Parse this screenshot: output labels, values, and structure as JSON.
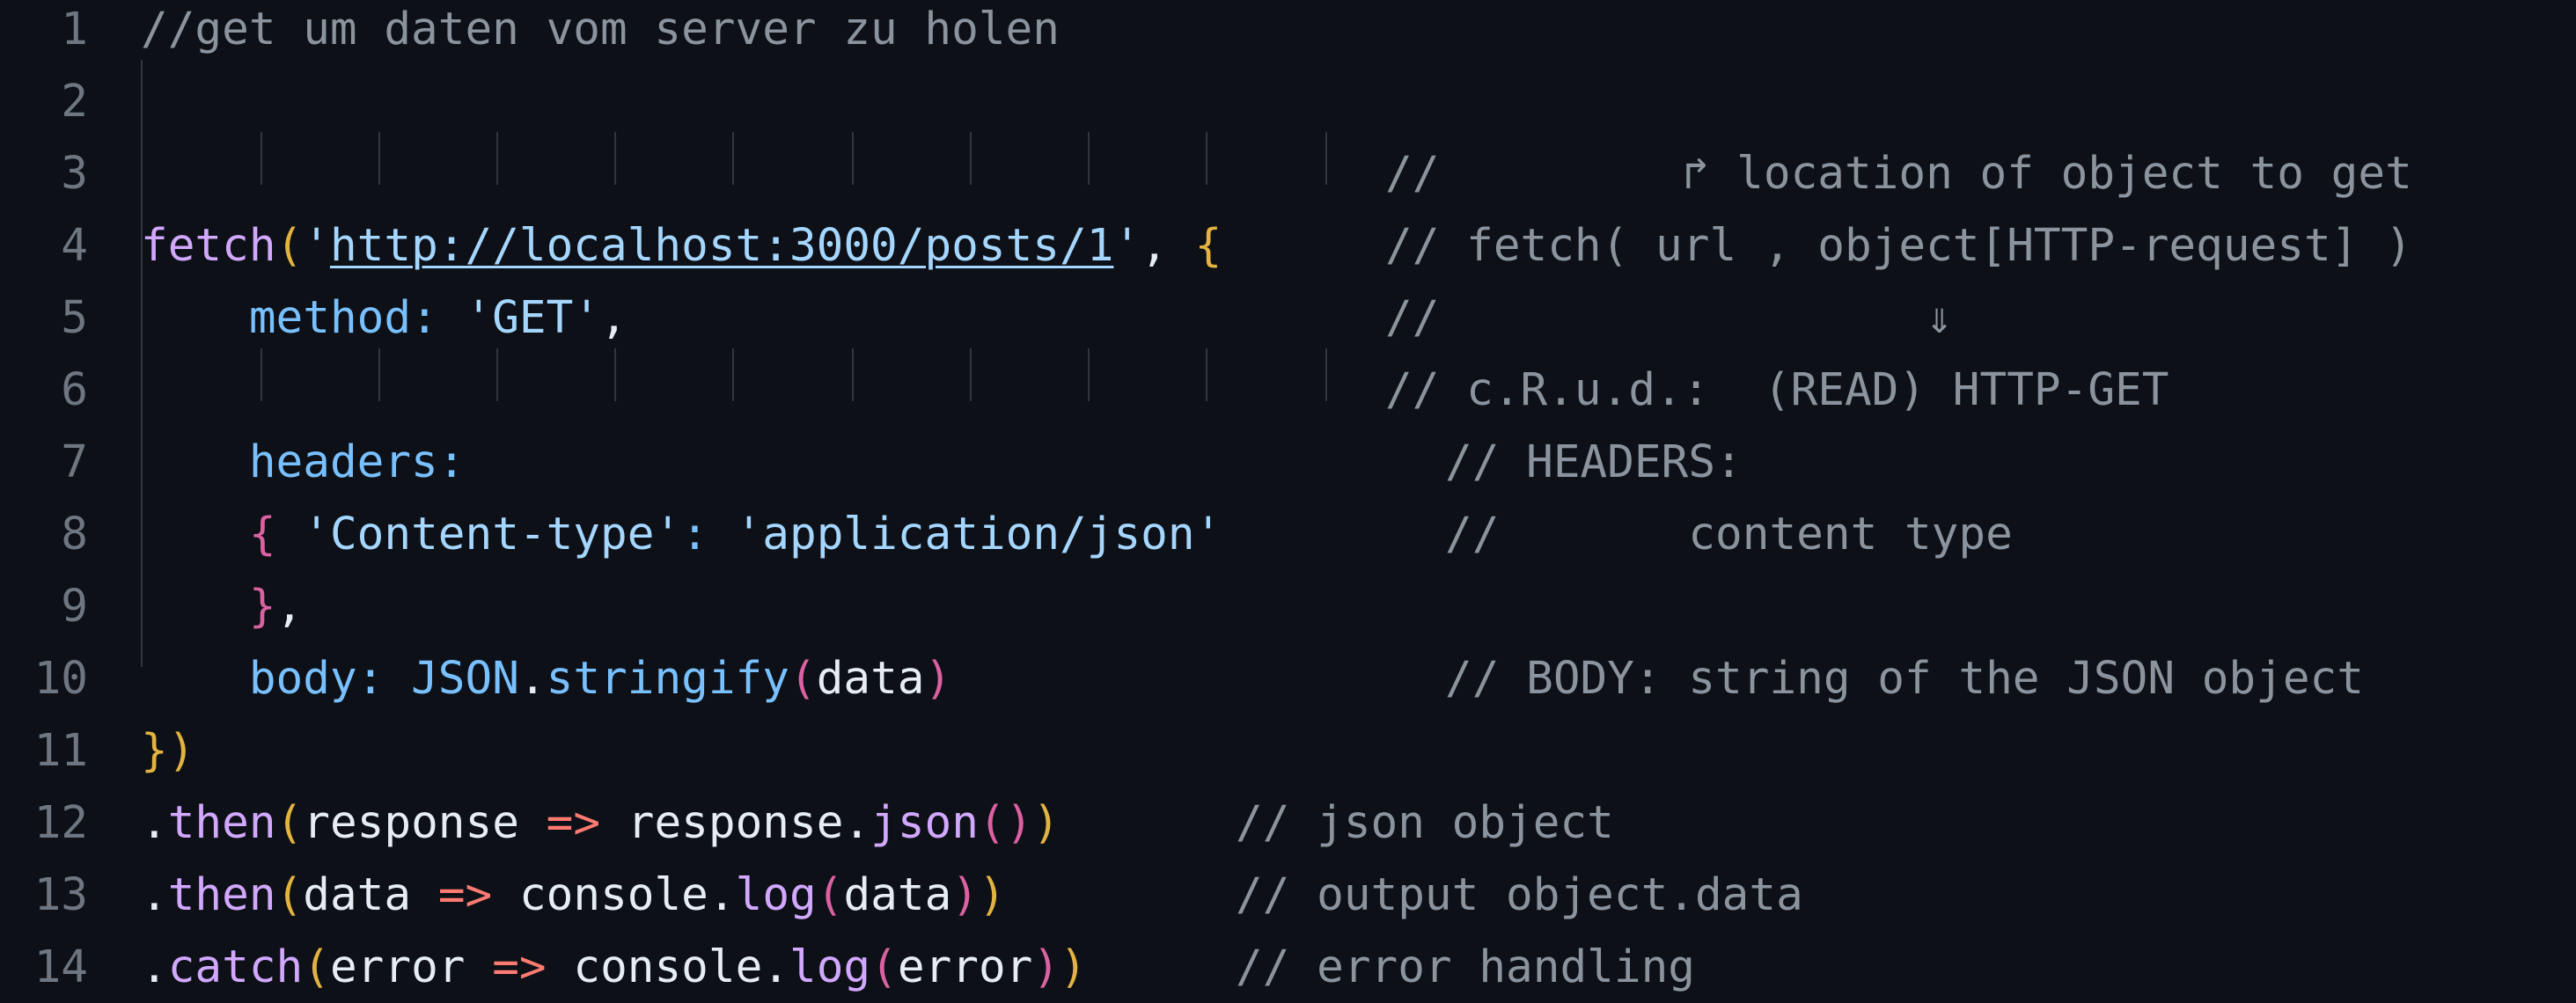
{
  "editor": {
    "line_numbers": [
      "1",
      "2",
      "3",
      "4",
      "5",
      "6",
      "7",
      "8",
      "9",
      "10",
      "11",
      "12",
      "13",
      "14"
    ],
    "colors": {
      "background": "#0d1117",
      "comment": "#8b949e",
      "line_number": "#6e7681",
      "function": "#d2a8ff",
      "property": "#79c0ff",
      "string": "#a5d6ff",
      "bracket_yellow": "#e3b341",
      "bracket_pink": "#db61a2",
      "operator": "#ff7b72"
    },
    "lines": {
      "l1": {
        "comment": "//get um daten vom server zu holen"
      },
      "l3": {
        "comment": "//         ↱ location of object to get"
      },
      "l4": {
        "fetch": "fetch",
        "paren_open": "(",
        "quote_open": "'",
        "url": "http://localhost:3000/posts/1",
        "quote_close": "'",
        "comma": ",",
        "brace_open": "{",
        "comment": "// fetch( url , object[HTTP-request] )"
      },
      "l5": {
        "key": "method:",
        "value": "'GET'",
        "comma": ",",
        "comment": "//                  ⇓"
      },
      "l6": {
        "comment": "// c.R.u.d.:  (READ) HTTP-GET"
      },
      "l7": {
        "key": "headers:",
        "comment": "// HEADERS:"
      },
      "l8": {
        "brace_open": "{",
        "key": "'Content-type'",
        "colon": ":",
        "value": "'application/json'",
        "comment": "//       content type"
      },
      "l9": {
        "brace_close": "}",
        "comma": ","
      },
      "l10": {
        "key": "body:",
        "obj": "JSON",
        "dot": ".",
        "method": "stringify",
        "paren_open": "(",
        "arg": "data",
        "paren_close": ")",
        "comment": "// BODY: string of the JSON object"
      },
      "l11": {
        "brace_close": "}",
        "paren_close": ")"
      },
      "l12": {
        "dot": ".",
        "method": "then",
        "paren_open": "(",
        "param": "response",
        "arrow": "=>",
        "obj": "response",
        "dot2": ".",
        "call": "json",
        "call_parens": "()",
        "paren_close": ")",
        "comment": "// json object"
      },
      "l13": {
        "dot": ".",
        "method": "then",
        "paren_open": "(",
        "param": "data",
        "arrow": "=>",
        "obj": "console",
        "dot2": ".",
        "call": "log",
        "call_open": "(",
        "arg": "data",
        "call_close": ")",
        "paren_close": ")",
        "comment": "// output object.data"
      },
      "l14": {
        "dot": ".",
        "method": "catch",
        "paren_open": "(",
        "param": "error",
        "arrow": "=>",
        "obj": "console",
        "dot2": ".",
        "call": "log",
        "call_open": "(",
        "arg": "error",
        "call_close": ")",
        "paren_close": ")",
        "comment": "// error handling"
      }
    }
  }
}
